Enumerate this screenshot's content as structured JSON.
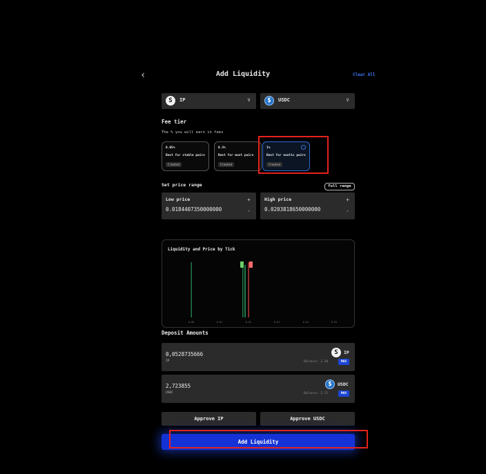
{
  "header": {
    "title": "Add Liquidity",
    "clear_label": "Clear All",
    "back_icon": "chevron-left-icon"
  },
  "tokens": [
    {
      "symbol": "IP",
      "icon": "ip-token-icon"
    },
    {
      "symbol": "USDC",
      "icon": "usdc-token-icon"
    }
  ],
  "fee": {
    "title": "Fee tier",
    "subtitle": "The % you will earn in fees",
    "tiers": [
      {
        "pct": "0.05%",
        "desc": "Best for stable pairs",
        "badge": "Created",
        "selected": false
      },
      {
        "pct": "0.3%",
        "desc": "Best for most pairs",
        "badge": "Created",
        "selected": false
      },
      {
        "pct": "1%",
        "desc": "Best for exotic pairs",
        "badge": "Created",
        "selected": true
      }
    ]
  },
  "range": {
    "title": "Set price range",
    "full_label": "Full range",
    "low": {
      "label": "Low price",
      "value": "0.0184407350000000"
    },
    "high": {
      "label": "High price",
      "value": "0.0203818650000000"
    }
  },
  "chart_data": {
    "type": "bar",
    "title": "Liquidity and Price by Tick",
    "ticks": [
      "0.00",
      "0.01",
      "0.01",
      "0.01",
      "0.01",
      "0.01"
    ]
  },
  "deposit": {
    "title": "Deposit Amounts",
    "items": [
      {
        "amount": "0,0528735666",
        "token": "IP",
        "symbol": "IP",
        "balance": "Balance: 2.30",
        "max": "MAX"
      },
      {
        "amount": "2,723855",
        "token": "USDC",
        "symbol": "USDC",
        "balance": "Balance: 2.72",
        "max": "MAX"
      }
    ]
  },
  "actions": {
    "approve_ip": "Approve IP",
    "approve_usdc": "Approve USDC",
    "add": "Add Liquidity"
  },
  "colors": {
    "accent": "#1432d6",
    "highlight": "#e8221c",
    "panel": "#2b2b2b"
  }
}
